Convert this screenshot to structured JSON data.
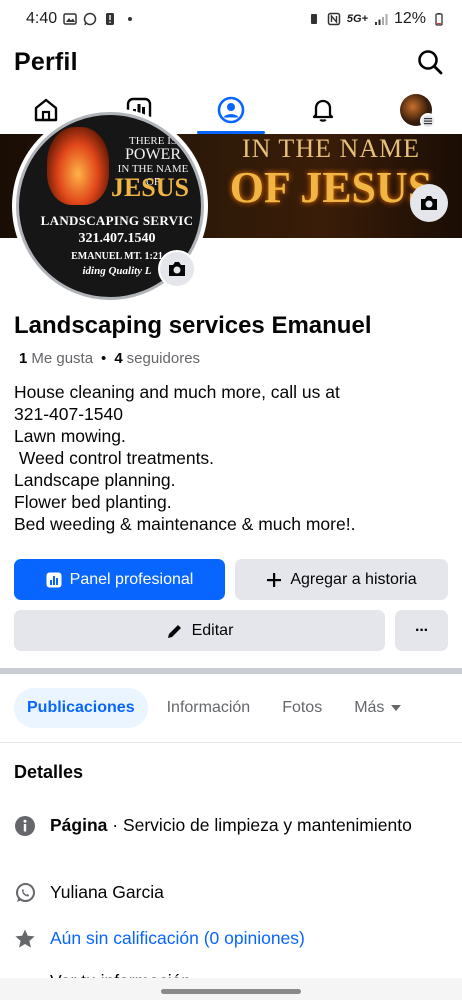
{
  "status_bar": {
    "time": "4:40",
    "network": "5G+",
    "battery": "12%"
  },
  "header": {
    "title": "Perfil"
  },
  "nav_tabs": [
    {
      "icon": "home-icon"
    },
    {
      "icon": "dashboard-icon"
    },
    {
      "icon": "profile-icon",
      "active": true
    },
    {
      "icon": "bell-icon"
    },
    {
      "icon": "avatar-menu-icon"
    }
  ],
  "cover": {
    "line1": "IN THE NAME",
    "line2": "OF JESUS"
  },
  "profile_picture": {
    "line1": "THERE IS",
    "line2": "POWER",
    "line3": "IN THE NAME",
    "line4": "OF",
    "line5": "JESUS",
    "services": "LANDSCAPING SERVIC",
    "phone": "321.407.1540",
    "verse": "EMANUEL MT. 1:21",
    "quality": "iding Quality L"
  },
  "page": {
    "name": "Landscaping services Emanuel",
    "likes_count": "1",
    "likes_label": "Me gusta",
    "followers_count": "4",
    "followers_label": "seguidores",
    "bio": [
      "House cleaning and much more, call us at",
      "321-407-1540",
      "Lawn mowing.",
      " Weed control treatments.",
      "Landscape planning.",
      "Flower bed planting.",
      "Bed weeding & maintenance & much more!."
    ]
  },
  "actions": {
    "dashboard": "Panel profesional",
    "add_story": "Agregar a historia",
    "edit": "Editar",
    "more": "···"
  },
  "profile_tabs": {
    "posts": "Publicaciones",
    "about": "Información",
    "photos": "Fotos",
    "more": "Más"
  },
  "details": {
    "title": "Detalles",
    "page_label": "Página",
    "page_category": " · Servicio de limpieza y mantenimiento",
    "whatsapp": "Yuliana Garcia",
    "rating": "Aún sin calificación (0 opiniones)",
    "info": "Ver tu información"
  },
  "colors": {
    "accent": "#0866ff",
    "secondary_button": "#e4e6eb",
    "muted_text": "#65676b"
  }
}
